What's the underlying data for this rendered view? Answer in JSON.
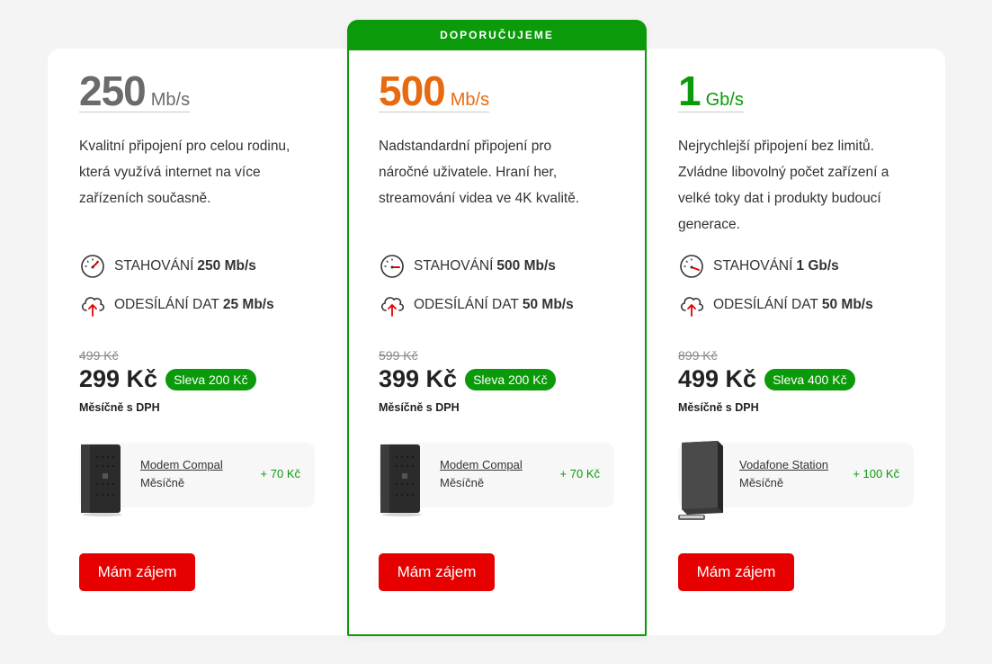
{
  "plans": [
    {
      "speed": "250",
      "unit": "Mb/s",
      "description": "Kvalitní připojení pro celou rodinu, která využívá internet na více zařízeních současně.",
      "download_label": "STAHOVÁNÍ",
      "download_value": "250 Mb/s",
      "upload_label": "ODESÍLÁNÍ DAT",
      "upload_value": "25 Mb/s",
      "old_price": "499 Kč",
      "price": "299 Kč",
      "discount": "Sleva 200 Kč",
      "period": "Měsíčně s DPH",
      "device_name": "Modem Compal",
      "device_period": "Měsíčně",
      "device_price": "+ 70 Kč",
      "cta": "Mám zájem"
    },
    {
      "badge": "DOPORUČUJEME",
      "speed": "500",
      "unit": "Mb/s",
      "description": "Nadstandardní připojení pro náročné uživatele. Hraní her, streamování videa ve 4K kvalitě.",
      "download_label": "STAHOVÁNÍ",
      "download_value": "500 Mb/s",
      "upload_label": "ODESÍLÁNÍ DAT",
      "upload_value": "50 Mb/s",
      "old_price": "599 Kč",
      "price": "399 Kč",
      "discount": "Sleva 200 Kč",
      "period": "Měsíčně s DPH",
      "device_name": "Modem Compal",
      "device_period": "Měsíčně",
      "device_price": "+ 70 Kč",
      "cta": "Mám zájem"
    },
    {
      "speed": "1",
      "unit": "Gb/s",
      "description": "Nejrychlejší připojení bez limitů. Zvládne libovolný počet zařízení a velké toky dat i produkty budoucí generace.",
      "download_label": "STAHOVÁNÍ",
      "download_value": "1 Gb/s",
      "upload_label": "ODESÍLÁNÍ DAT",
      "upload_value": "50 Mb/s",
      "old_price": "899 Kč",
      "price": "499 Kč",
      "discount": "Sleva 400 Kč",
      "period": "Měsíčně s DPH",
      "device_name": "Vodafone Station",
      "device_period": "Měsíčně",
      "device_price": "+ 100 Kč",
      "cta": "Mám zájem"
    }
  ],
  "colors": {
    "accent_red": "#e60000",
    "green": "#0a9a0a",
    "orange": "#e86a10",
    "grey_speed": "#6b6b6b"
  },
  "icons": {
    "download": "speedometer-icon",
    "upload": "cloud-upload-icon",
    "modem": "modem-device-image",
    "station": "vodafone-station-image"
  }
}
